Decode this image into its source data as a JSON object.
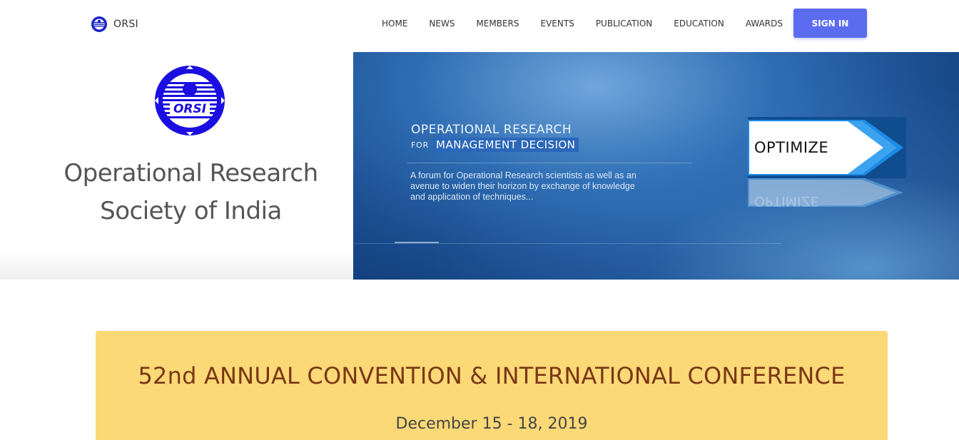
{
  "navbar": {
    "brand": "ORSI",
    "links": [
      "HOME",
      "NEWS",
      "MEMBERS",
      "EVENTS",
      "PUBLICATION",
      "EDUCATION",
      "AWARDS"
    ],
    "signin_label": "SIGN IN",
    "accent_color": "#5b6cf0"
  },
  "hero": {
    "logo_text": "ORSI",
    "org_title_line1": "Operational Research",
    "org_title_line2": "Society of India",
    "banner": {
      "title": "OPERATIONAL RESEARCH",
      "sub_for": "FOR",
      "sub_decision": "MANAGEMENT DECISION",
      "description": "A forum for Operational Research scientists as well as an avenue to widen their horizon by exchange of knowledge and application of techniques...",
      "optimize": "OPTIMIZE"
    }
  },
  "conference": {
    "title": "52nd ANNUAL CONVENTION & INTERNATIONAL CONFERENCE",
    "date": "December 15 - 18, 2019",
    "background_color": "#fbd977",
    "title_color": "#7a3714"
  },
  "icons": {
    "brand_logo": "orsi-logo-icon"
  }
}
